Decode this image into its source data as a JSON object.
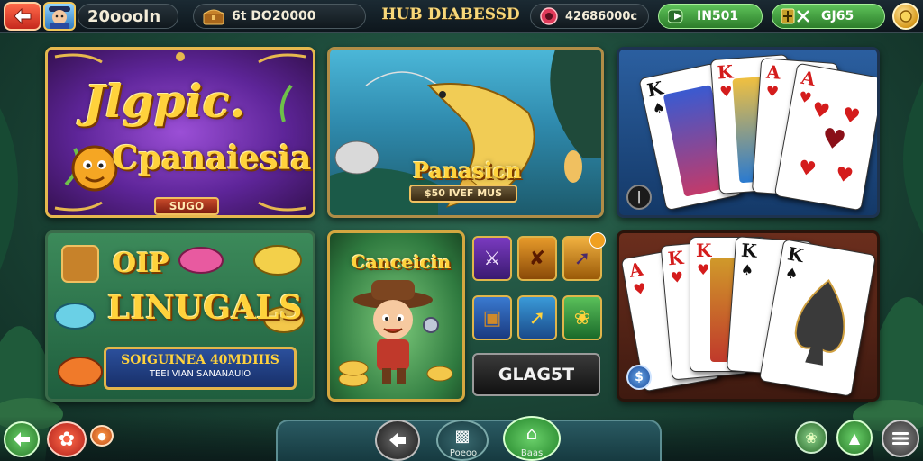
{
  "topbar": {
    "player_name": "20oooln",
    "treasure_value": "6t DO20000",
    "hub_title": "HUB DIABESSD",
    "gems_value": "42686000c",
    "pill_green_1": "IN501",
    "pill_green_2": "GJ65"
  },
  "tiles": {
    "magic": {
      "title_line1": "Jlgpic.",
      "title_line2": "Cpanaiesia",
      "plate": "SUGO"
    },
    "fish": {
      "title": "Panasicn",
      "plate": "$50 IVEF MUS"
    },
    "fishgame": {
      "title_line1": "OIP",
      "title_line2": "LINUGALS",
      "banner_line1": "SOIGUINEA 40MDIIIS",
      "banner_line2": "TEEI VIAN SANANAUIO"
    },
    "explorer": {
      "title": "Canceicin"
    },
    "glass_button": "GLAG5T",
    "cards1": {
      "ranks": [
        "K",
        "K",
        "A",
        "A"
      ]
    },
    "cards2": {
      "ranks": [
        "A",
        "K",
        "K",
        "K",
        "K"
      ]
    }
  },
  "bottombar": {
    "nav_center_label": "Poeoo",
    "nav_home_label": "Baas"
  },
  "colors": {
    "gold": "#e6b84e",
    "accent_red": "#c6281d",
    "accent_green": "#2c7d2a"
  },
  "icons": [
    "back-arrow-icon",
    "treasure-chest-icon",
    "gem-icon",
    "coin-icon",
    "home-icon",
    "menu-icon",
    "settings-gear-icon"
  ]
}
